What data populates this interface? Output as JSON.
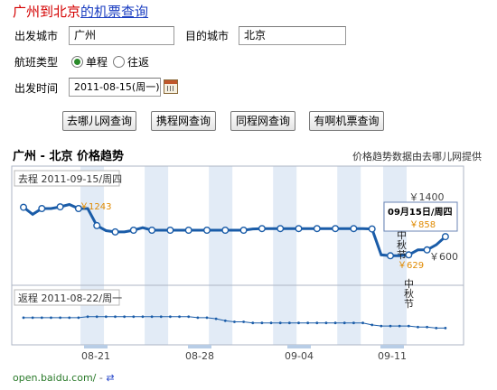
{
  "title": {
    "origin": "广州",
    "to": "到",
    "destination": "北京",
    "suffix": "的机票查询"
  },
  "form": {
    "depart_city_label": "出发城市",
    "depart_city_value": "广州",
    "arrive_city_label": "目的城市",
    "arrive_city_value": "北京",
    "trip_type_label": "航班类型",
    "one_way_label": "单程",
    "round_trip_label": "往返",
    "trip_type_selected": "one_way",
    "date_label": "出发时间",
    "date_value": "2011-08-15(周一)"
  },
  "buttons": [
    "去哪儿网查询",
    "携程网查询",
    "同程网查询",
    "有啊机票查询"
  ],
  "chart_header": {
    "route": "广州 - 北京 价格趋势",
    "provider": "价格趋势数据由去哪儿网提供"
  },
  "chart_data": {
    "type": "line",
    "outbound": {
      "label": "去程 2011-09-15/周四",
      "y_ticks": [
        "￥1400",
        "￥600"
      ],
      "ylim": [
        500,
        1500
      ],
      "values": [
        1210,
        1125,
        1195,
        1195,
        1215,
        1243,
        1195,
        1195,
        990,
        930,
        915,
        915,
        935,
        965,
        935,
        935,
        935,
        935,
        935,
        935,
        935,
        935,
        935,
        935,
        935,
        950,
        955,
        955,
        955,
        955,
        955,
        955,
        955,
        955,
        955,
        955,
        955,
        955,
        950,
        640,
        629,
        629,
        640,
        700,
        700,
        760,
        858
      ],
      "high_label": "￥1243",
      "low_label": "￥629",
      "holiday_text": "中秋节",
      "tooltip_date": "09月15日/周四",
      "tooltip_price": "￥858"
    },
    "return": {
      "label": "返程 2011-08-22/周一",
      "values": [
        6,
        6,
        6,
        6,
        6,
        6,
        6,
        5,
        5,
        5,
        5,
        5,
        5,
        5,
        5,
        5,
        5,
        5,
        5,
        6,
        6,
        7,
        9,
        10,
        10,
        11,
        11,
        11,
        11,
        11,
        11,
        11,
        11,
        11,
        11,
        11,
        11,
        11,
        13,
        14,
        14,
        14,
        14,
        15,
        15,
        16,
        16
      ],
      "holiday_text": "中秋节"
    },
    "x_ticks": [
      "08-21",
      "08-28",
      "09-04",
      "09-11"
    ]
  },
  "footer": {
    "link": "open.baidu.com/",
    "sep": "-",
    "icon": "⇄"
  },
  "colors": {
    "title_red": "#d40000",
    "title_blue": "#1a3dc1",
    "line_blue": "#1a5ca8",
    "price_orange": "#e08a00",
    "weekend_band": "#dde8f4"
  }
}
